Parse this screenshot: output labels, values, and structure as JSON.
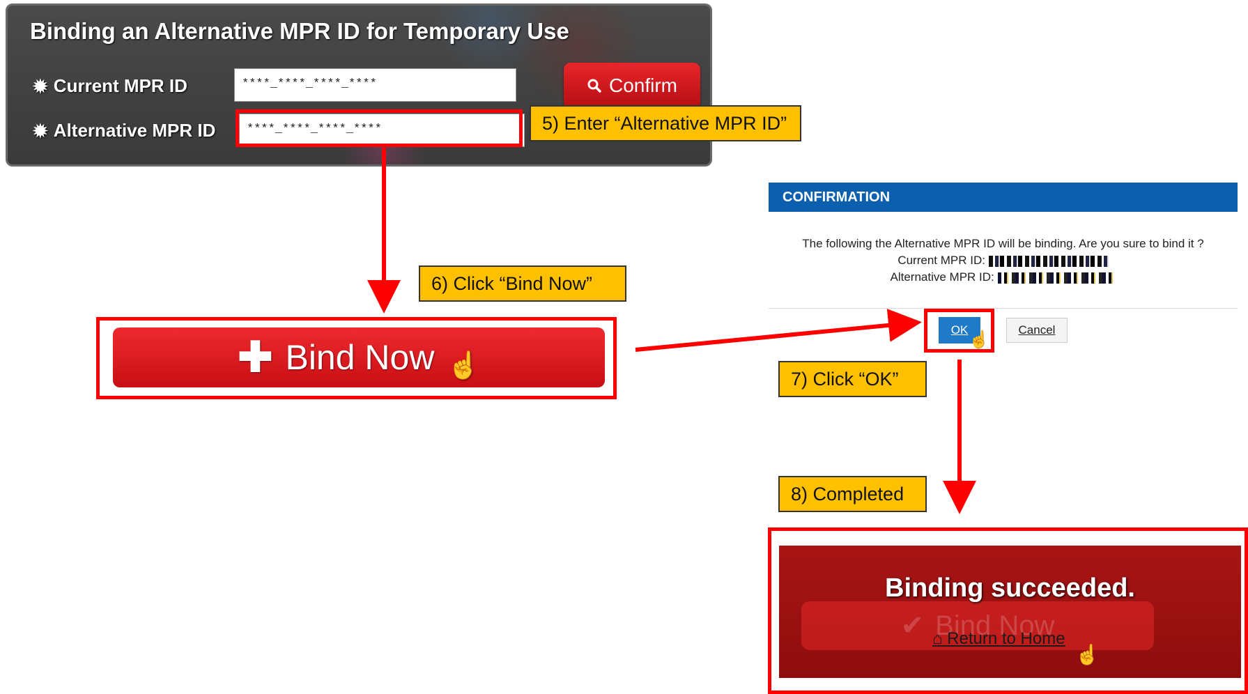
{
  "form": {
    "title": "Binding an Alternative MPR ID for Temporary Use",
    "current_label": "Current MPR ID",
    "alternative_label": "Alternative MPR ID",
    "current_value": "****_****_****_****",
    "alternative_value": "****_****_****_****",
    "confirm_label": "Confirm"
  },
  "steps": {
    "step5": "5) Enter “Alternative MPR ID”",
    "step6": "6) Click “Bind Now”",
    "step7": "7) Click “OK”",
    "step8": "8) Completed"
  },
  "bind_now": {
    "label": "Bind Now"
  },
  "dialog": {
    "header": "CONFIRMATION",
    "message": "The following the Alternative MPR ID will be binding. Are you sure to bind it ?",
    "current_label": "Current MPR ID:",
    "alternative_label": "Alternative MPR ID:",
    "ok_label": "OK",
    "cancel_label": "Cancel"
  },
  "success": {
    "title": "Binding succeeded.",
    "ghost_label": "Bind Now",
    "return_label": "Return to Home"
  },
  "colors": {
    "callout": "#ffc000",
    "highlight": "#ff0000",
    "dialog_header": "#0b5fae",
    "button_red": "#e8262b"
  }
}
